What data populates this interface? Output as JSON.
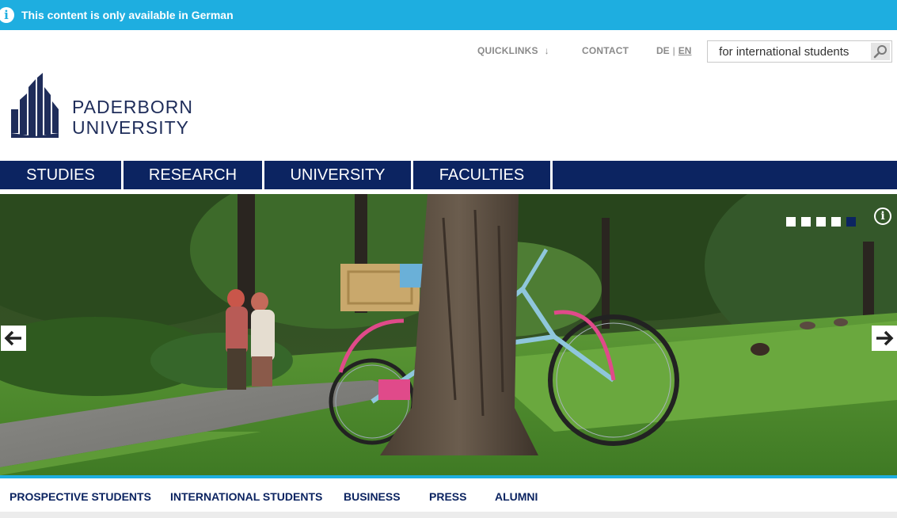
{
  "banner": {
    "icon": "info-icon",
    "text": "This content is only available in German",
    "color": "#1eaee0"
  },
  "topnav": {
    "quicklinks": "QUICKLINKS",
    "quicklinks_arrow": "↓",
    "contact": "CONTACT",
    "lang_de": "DE",
    "lang_sep": "|",
    "lang_en": "EN",
    "search_value": " for international students",
    "search_icon": "magnifier-icon"
  },
  "logo": {
    "line1": "PADERBORN",
    "line2": "UNIVERSITY",
    "color": "#1f2d5a"
  },
  "mainnav": {
    "color": "#0c2461",
    "items": [
      {
        "label": "STUDIES"
      },
      {
        "label": "RESEARCH"
      },
      {
        "label": "UNIVERSITY"
      },
      {
        "label": "FACULTIES"
      }
    ]
  },
  "hero": {
    "slide_count": 5,
    "active_slide": 5,
    "prev_arrow": "🡐",
    "next_arrow": "🡒",
    "info_icon": "i",
    "image_icon": "park-bicycle-photo"
  },
  "subnav": {
    "items": [
      {
        "label": "PROSPECTIVE STUDENTS"
      },
      {
        "label": "INTERNATIONAL STUDENTS"
      },
      {
        "label": "BUSINESS"
      },
      {
        "label": "PRESS"
      },
      {
        "label": "ALUMNI"
      }
    ]
  }
}
